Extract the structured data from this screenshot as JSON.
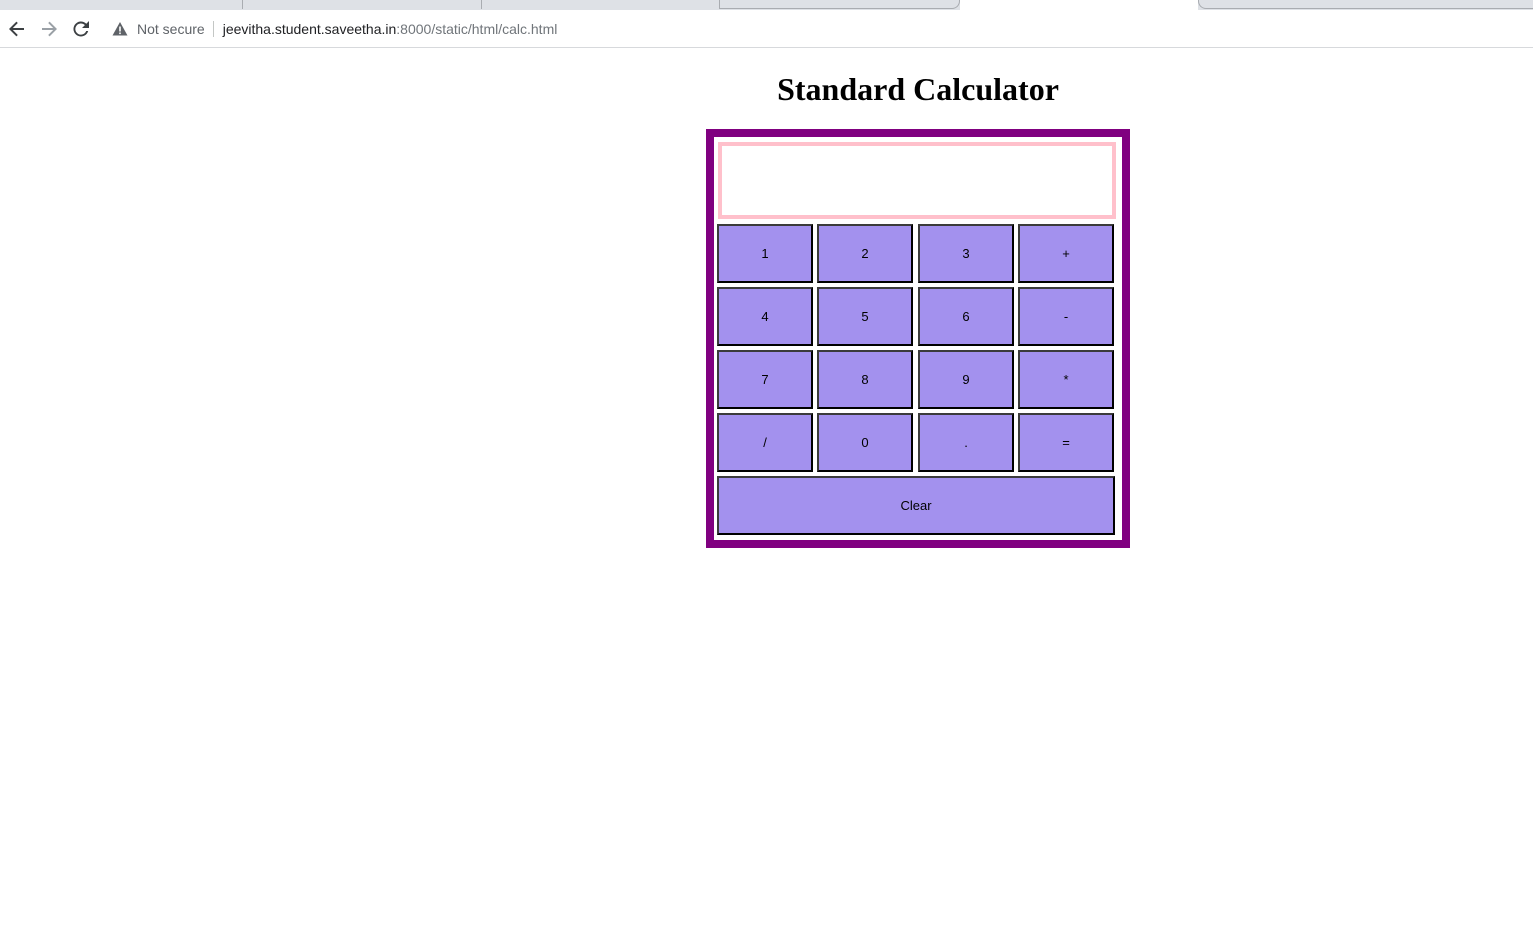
{
  "browser": {
    "security_label": "Not secure",
    "url_host": "jeevitha.student.saveetha.in",
    "url_rest": ":8000/static/html/calc.html"
  },
  "page": {
    "title": "Standard Calculator"
  },
  "calculator": {
    "display_value": "",
    "keys": [
      {
        "label": "1",
        "id": "key-1"
      },
      {
        "label": "2",
        "id": "key-2"
      },
      {
        "label": "3",
        "id": "key-3"
      },
      {
        "label": "+",
        "id": "key-plus"
      },
      {
        "label": "4",
        "id": "key-4"
      },
      {
        "label": "5",
        "id": "key-5"
      },
      {
        "label": "6",
        "id": "key-6"
      },
      {
        "label": "-",
        "id": "key-minus"
      },
      {
        "label": "7",
        "id": "key-7"
      },
      {
        "label": "8",
        "id": "key-8"
      },
      {
        "label": "9",
        "id": "key-9"
      },
      {
        "label": "*",
        "id": "key-multiply"
      },
      {
        "label": "/",
        "id": "key-divide"
      },
      {
        "label": "0",
        "id": "key-0"
      },
      {
        "label": ".",
        "id": "key-decimal"
      },
      {
        "label": "=",
        "id": "key-equals"
      }
    ],
    "clear_label": "Clear"
  },
  "colors": {
    "frame": "#800080",
    "display_border": "#ffc0cb",
    "key_fill": "#a391ee"
  }
}
